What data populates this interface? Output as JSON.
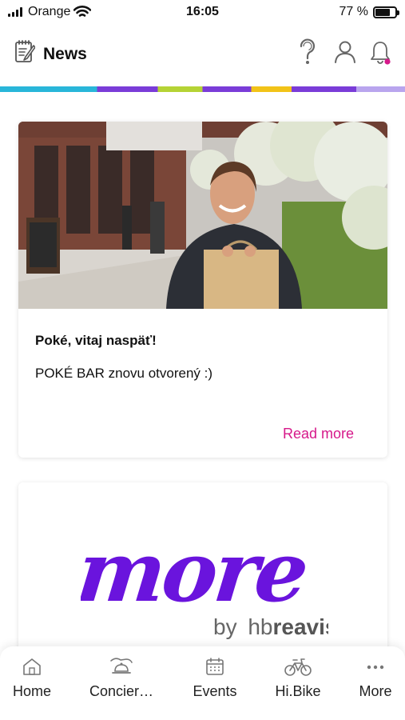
{
  "status_bar": {
    "carrier": "Orange",
    "time": "16:05",
    "battery": "77 %",
    "battery_level": 0.77
  },
  "header": {
    "title": "News"
  },
  "accent_colors": {
    "cyan": "#29b6d9",
    "purple": "#7a3cd8",
    "lime": "#b5d335",
    "yellow": "#f2c318",
    "lavender": "#b9a5ee",
    "link_pink": "#d6198a"
  },
  "news_card": {
    "title": "Poké, vitaj naspäť!",
    "excerpt": "POKÉ BAR znovu otvorený :)",
    "read_more": "Read more"
  },
  "promo_card": {
    "logo_word": "more",
    "by_text": "by",
    "brand_hb": "hb",
    "brand_reavis": "reavis"
  },
  "tabbar": {
    "items": [
      {
        "label": "Home",
        "icon": "home-icon"
      },
      {
        "label": "Concier…",
        "icon": "concierge-icon"
      },
      {
        "label": "Events",
        "icon": "calendar-icon"
      },
      {
        "label": "Hi.Bike",
        "icon": "bike-icon"
      },
      {
        "label": "More",
        "icon": "more-dots-icon"
      }
    ]
  }
}
